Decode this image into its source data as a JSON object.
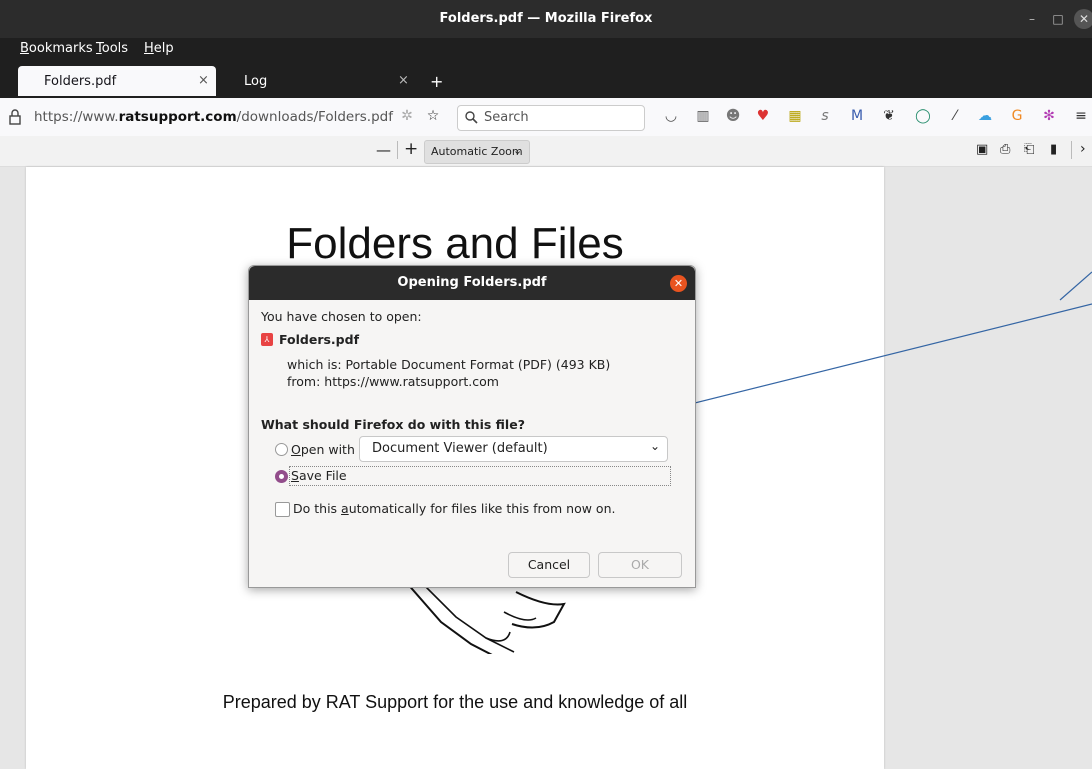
{
  "window": {
    "title": "Folders.pdf — Mozilla Firefox"
  },
  "menu": {
    "bookmarks": "ookmarks",
    "bookmarks_key": "B",
    "tools": "ools",
    "tools_key": "T",
    "help": "elp",
    "help_key": "H"
  },
  "tabs": [
    {
      "label": "Folders.pdf",
      "active": true
    },
    {
      "label": "Log",
      "active": false
    }
  ],
  "tab_close_glyph": "×",
  "new_tab_glyph": "+",
  "address": {
    "prefix": "https://www.",
    "domain": "ratsupport.com",
    "path": "/downloads/Folders.pdf"
  },
  "search": {
    "placeholder": "Search"
  },
  "pdf_toolbar": {
    "zoom_out": "—",
    "zoom_in": "+",
    "zoom_label": "Automatic Zoom"
  },
  "pdf_page": {
    "heading": "Folders and Files",
    "prepared": "Prepared by RAT Support for the use and knowledge of all"
  },
  "dialog": {
    "title": "Opening Folders.pdf",
    "intro": "You have chosen to open:",
    "file_name": "Folders.pdf",
    "which_is": "which is: Portable Document Format (PDF) (493 KB)",
    "from": "from: https://www.ratsupport.com",
    "question": "What should Firefox do with this file?",
    "open_with_key": "O",
    "open_with_label": "pen with",
    "viewer": "Document Viewer (default)",
    "save_key": "S",
    "save_label": "ave File",
    "auto_prefix": "Do this ",
    "auto_key": "a",
    "auto_suffix": "utomatically for files like this from now on.",
    "cancel": "Cancel",
    "ok": "OK",
    "selected_option": "Save File"
  },
  "colors": {
    "accent": "#924d8b",
    "close": "#e95420",
    "arrow": "#3465a4"
  }
}
